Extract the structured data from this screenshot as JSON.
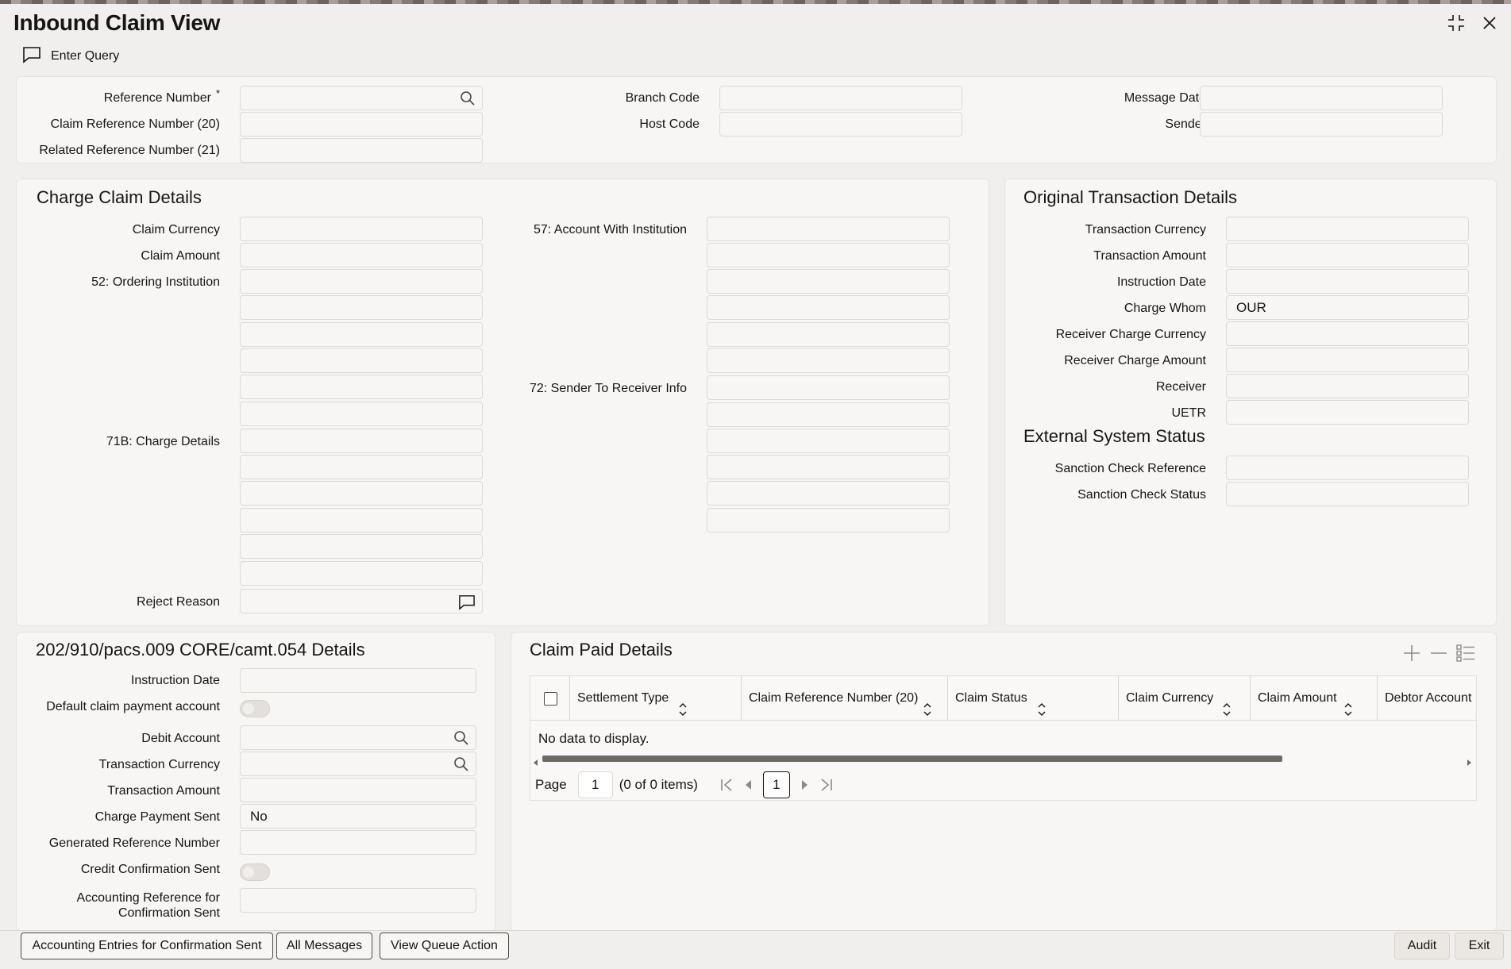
{
  "window": {
    "title": "Inbound Claim View"
  },
  "toolbar": {
    "enter_query": "Enter Query"
  },
  "header": {
    "reference_number_label": "Reference Number",
    "required_mark": "*",
    "claim_reference_label": "Claim Reference Number (20)",
    "related_reference_label": "Related Reference Number (21)",
    "branch_code_label": "Branch Code",
    "host_code_label": "Host Code",
    "message_date_label": "Message Date",
    "sender_label": "Sender",
    "reference_number": "",
    "claim_reference": "",
    "related_reference": "",
    "branch_code": "",
    "host_code": "",
    "message_date": "",
    "sender": ""
  },
  "charge_claim": {
    "title": "Charge Claim Details",
    "claim_currency_label": "Claim Currency",
    "claim_amount_label": "Claim Amount",
    "ordering_institution_label": "52: Ordering Institution",
    "charge_details_label": "71B: Charge Details",
    "reject_reason_label": "Reject Reason",
    "account_with_label": "57: Account With Institution",
    "sender_to_receiver_label": "72: Sender To Receiver Info"
  },
  "original_txn": {
    "title": "Original Transaction Details",
    "transaction_currency_label": "Transaction Currency",
    "transaction_amount_label": "Transaction Amount",
    "instruction_date_label": "Instruction Date",
    "charge_whom_label": "Charge Whom",
    "charge_whom_value": "OUR",
    "receiver_charge_currency_label": "Receiver Charge Currency",
    "receiver_charge_amount_label": "Receiver Charge Amount",
    "receiver_label": "Receiver",
    "uetr_label": "UETR"
  },
  "external_status": {
    "title": "External System Status",
    "sanction_ref_label": "Sanction Check Reference",
    "sanction_status_label": "Sanction Check Status"
  },
  "pacs_details": {
    "title": "202/910/pacs.009 CORE/camt.054 Details",
    "instruction_date_label": "Instruction Date",
    "default_claim_label": "Default claim payment account",
    "debit_account_label": "Debit Account",
    "transaction_currency_label": "Transaction Currency",
    "transaction_amount_label": "Transaction Amount",
    "charge_payment_sent_label": "Charge Payment Sent",
    "charge_payment_sent_value": "No",
    "generated_ref_label": "Generated Reference Number",
    "credit_confirmation_label": "Credit Confirmation Sent",
    "accounting_ref_label_1": "Accounting Reference for",
    "accounting_ref_label_2": "Confirmation Sent"
  },
  "claim_paid": {
    "title": "Claim Paid Details",
    "columns": [
      "Settlement Type",
      "Claim Reference Number (20)",
      "Claim Status",
      "Claim Currency",
      "Claim Amount",
      "Debtor Account N"
    ],
    "no_data": "No data to display.",
    "page_label": "Page",
    "page_value": "1",
    "items_text": "(0 of 0 items)",
    "current_page": "1"
  },
  "footer": {
    "btn_accounting": "Accounting Entries for Confirmation Sent",
    "btn_all_messages": "All Messages",
    "btn_view_queue": "View Queue Action",
    "btn_audit": "Audit",
    "btn_exit": "Exit"
  }
}
